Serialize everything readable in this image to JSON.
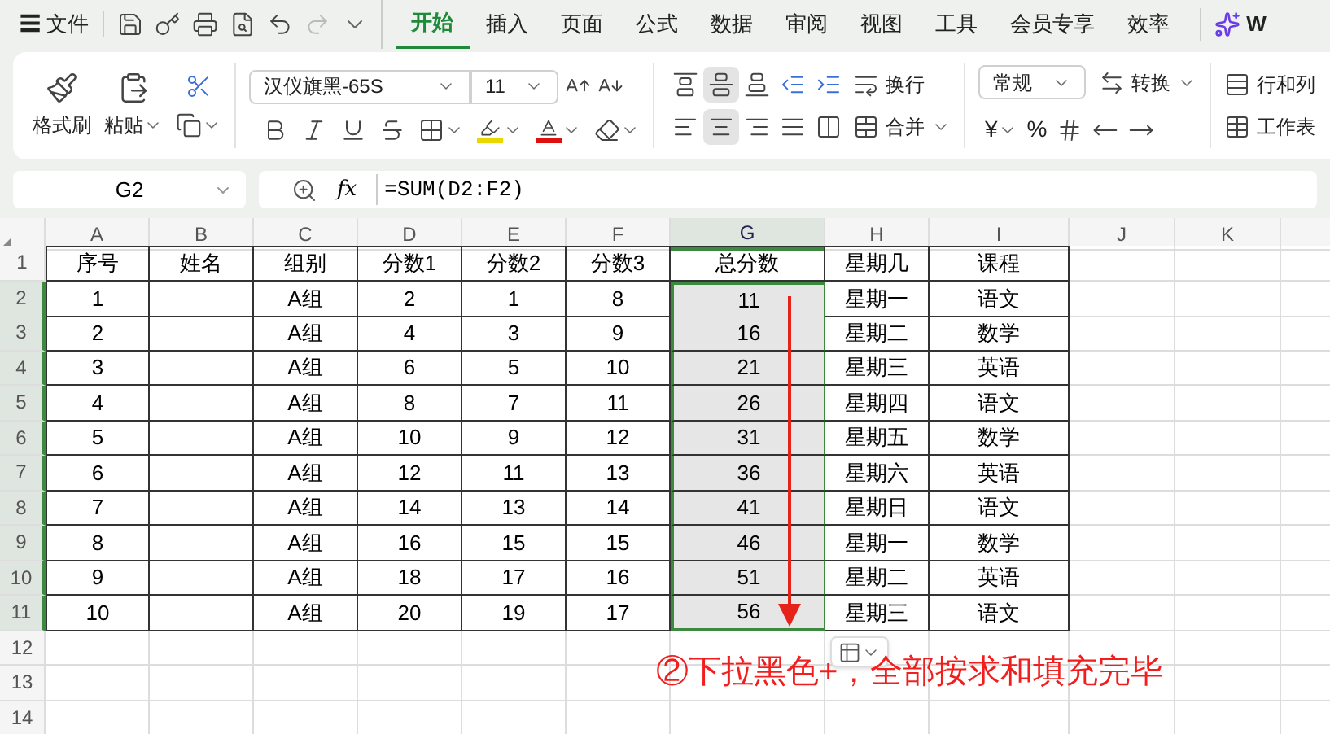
{
  "title_bar": {
    "menu_icon": "☰",
    "file_label": "文件",
    "redo": {
      "disabled": true
    },
    "logo_text": "W"
  },
  "menu_tabs": [
    {
      "label": "开始",
      "selected": true
    },
    {
      "label": "插入",
      "selected": false
    },
    {
      "label": "页面",
      "selected": false
    },
    {
      "label": "公式",
      "selected": false
    },
    {
      "label": "数据",
      "selected": false
    },
    {
      "label": "审阅",
      "selected": false
    },
    {
      "label": "视图",
      "selected": false
    },
    {
      "label": "工具",
      "selected": false
    },
    {
      "label": "会员专享",
      "selected": false
    },
    {
      "label": "效率",
      "selected": false
    }
  ],
  "ribbon": {
    "format_painter": "格式刷",
    "paste": "粘贴",
    "font_name": "汉仪旗黑-65S",
    "font_size": "11",
    "wrap": "换行",
    "merge": "合并",
    "number_format": "常规",
    "convert": "转换",
    "currency": "¥",
    "percent": "%",
    "rows_cols": "行和列",
    "worksheet": "工作表",
    "vertical_align": [
      {
        "selected": false
      },
      {
        "selected": true
      },
      {
        "selected": false
      }
    ],
    "horizontal_align": [
      {
        "selected": false
      },
      {
        "selected": true
      },
      {
        "selected": false
      },
      {
        "selected": false
      }
    ]
  },
  "formula_bar": {
    "name_box": "G2",
    "fx": "fx",
    "formula": "=SUM(D2:F2)"
  },
  "sheet": {
    "columns": [
      {
        "label": "A",
        "selected": false
      },
      {
        "label": "B",
        "selected": false
      },
      {
        "label": "C",
        "selected": false
      },
      {
        "label": "D",
        "selected": false
      },
      {
        "label": "E",
        "selected": false
      },
      {
        "label": "F",
        "selected": false
      },
      {
        "label": "G",
        "selected": true
      },
      {
        "label": "H",
        "selected": false
      },
      {
        "label": "I",
        "selected": false
      },
      {
        "label": "J",
        "selected": false
      },
      {
        "label": "K",
        "selected": false
      }
    ],
    "rows": [
      {
        "number": "1",
        "selected": false,
        "cells": [
          "序号",
          "姓名",
          "组别",
          "分数1",
          "分数2",
          "分数3",
          "总分数",
          "星期几",
          "课程"
        ]
      },
      {
        "number": "2",
        "selected": true,
        "cells": [
          "1",
          "",
          "A组",
          "2",
          "1",
          "8",
          "11",
          "星期一",
          "语文"
        ]
      },
      {
        "number": "3",
        "selected": true,
        "cells": [
          "2",
          "",
          "A组",
          "4",
          "3",
          "9",
          "16",
          "星期二",
          "数学"
        ]
      },
      {
        "number": "4",
        "selected": true,
        "cells": [
          "3",
          "",
          "A组",
          "6",
          "5",
          "10",
          "21",
          "星期三",
          "英语"
        ]
      },
      {
        "number": "5",
        "selected": true,
        "cells": [
          "4",
          "",
          "A组",
          "8",
          "7",
          "11",
          "26",
          "星期四",
          "语文"
        ]
      },
      {
        "number": "6",
        "selected": true,
        "cells": [
          "5",
          "",
          "A组",
          "10",
          "9",
          "12",
          "31",
          "星期五",
          "数学"
        ]
      },
      {
        "number": "7",
        "selected": true,
        "cells": [
          "6",
          "",
          "A组",
          "12",
          "11",
          "13",
          "36",
          "星期六",
          "英语"
        ]
      },
      {
        "number": "8",
        "selected": true,
        "cells": [
          "7",
          "",
          "A组",
          "14",
          "13",
          "14",
          "41",
          "星期日",
          "语文"
        ]
      },
      {
        "number": "9",
        "selected": true,
        "cells": [
          "8",
          "",
          "A组",
          "16",
          "15",
          "15",
          "46",
          "星期一",
          "数学"
        ]
      },
      {
        "number": "10",
        "selected": true,
        "cells": [
          "9",
          "",
          "A组",
          "18",
          "17",
          "16",
          "51",
          "星期二",
          "英语"
        ]
      },
      {
        "number": "11",
        "selected": true,
        "cells": [
          "10",
          "",
          "A组",
          "20",
          "19",
          "17",
          "56",
          "星期三",
          "语文"
        ]
      },
      {
        "number": "12",
        "selected": false,
        "cells": []
      },
      {
        "number": "13",
        "selected": false,
        "cells": []
      },
      {
        "number": "14",
        "selected": false,
        "cells": []
      }
    ]
  },
  "annotation": "②下拉黑色+，全部按求和填充完毕"
}
